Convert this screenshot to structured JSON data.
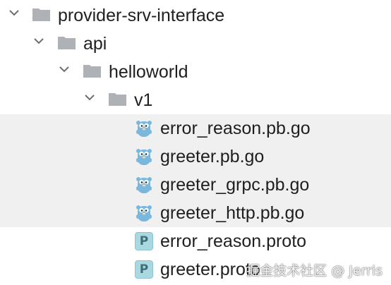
{
  "tree": {
    "items": [
      {
        "label": "provider-srv-interface",
        "type": "folder",
        "expanded": true
      },
      {
        "label": "api",
        "type": "folder",
        "expanded": true
      },
      {
        "label": "helloworld",
        "type": "folder",
        "expanded": true
      },
      {
        "label": "v1",
        "type": "folder",
        "expanded": true
      },
      {
        "label": "error_reason.pb.go",
        "type": "go-file",
        "selected": true
      },
      {
        "label": "greeter.pb.go",
        "type": "go-file",
        "selected": true
      },
      {
        "label": "greeter_grpc.pb.go",
        "type": "go-file",
        "selected": true
      },
      {
        "label": "greeter_http.pb.go",
        "type": "go-file",
        "selected": true
      },
      {
        "label": "error_reason.proto",
        "type": "proto-file",
        "badge": "P"
      },
      {
        "label": "greeter.proto",
        "type": "proto-file",
        "badge": "P"
      }
    ]
  },
  "watermark": "掘金技术社区 @ Jerris",
  "colors": {
    "selection": "#f0f0f1",
    "folder": "#aeb1b6",
    "gopher": "#79b8dc",
    "proto_badge": "#a9d8e0"
  }
}
